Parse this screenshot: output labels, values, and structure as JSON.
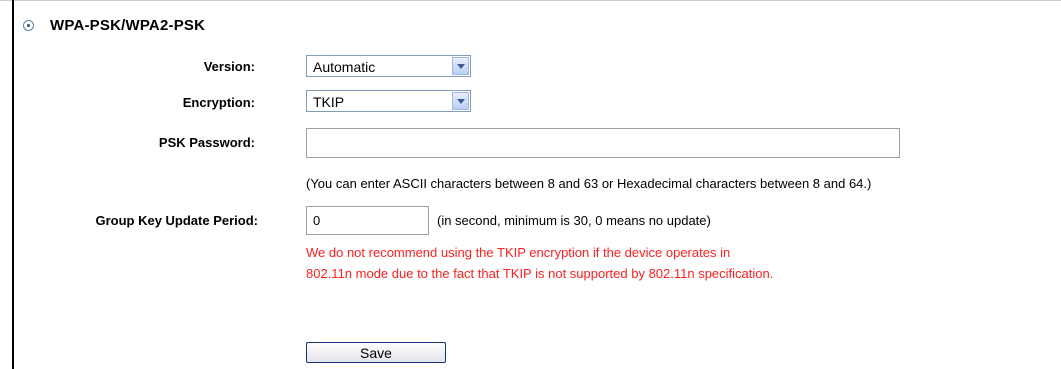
{
  "section": {
    "title": "WPA-PSK/WPA2-PSK",
    "selected": true
  },
  "version": {
    "label": "Version:",
    "value": "Automatic"
  },
  "encryption": {
    "label": "Encryption:",
    "value": "TKIP"
  },
  "psk_password": {
    "label": "PSK Password:",
    "value": "",
    "hint": "(You can enter ASCII characters between 8 and 63 or Hexadecimal characters between 8 and 64.)"
  },
  "group_key": {
    "label": "Group Key Update Period:",
    "value": "0",
    "hint": "(in second, minimum is 30, 0 means no update)"
  },
  "warning": {
    "line1": "We do not recommend using the TKIP encryption if the device operates in",
    "line2": "802.11n mode due to the fact that TKIP is not supported by 802.11n specification."
  },
  "save_button": {
    "label": "Save"
  },
  "colors": {
    "warning": "#ff2020",
    "button_border": "#1a2f7e"
  }
}
